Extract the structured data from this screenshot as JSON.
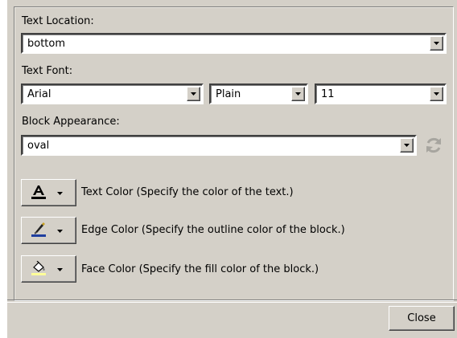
{
  "text_location": {
    "label": "Text Location:",
    "value": "bottom"
  },
  "text_font": {
    "label": "Text Font:",
    "family": "Arial",
    "style": "Plain",
    "size": "11"
  },
  "block_appearance": {
    "label": "Block Appearance:",
    "value": "oval",
    "refresh_icon": "refresh-icon"
  },
  "color_buttons": [
    {
      "icon": "text-color-icon",
      "label": "Text Color (Specify the color of the text.)"
    },
    {
      "icon": "edge-color-icon",
      "label": "Edge Color (Specify the outline color of the block.)"
    },
    {
      "icon": "face-color-icon",
      "label": "Face Color (Specify the fill color of the block.)"
    }
  ],
  "footer": {
    "close_label": "Close"
  },
  "colors": {
    "dialog_bg": "#d4d0c8",
    "text_color_bar": "#000000",
    "edge_color_bar": "#1f3f9f",
    "face_color_bar": "#ffff99"
  }
}
